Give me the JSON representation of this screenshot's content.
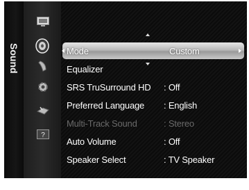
{
  "tab": {
    "label": "Sound"
  },
  "icons": [
    {
      "name": "picture-icon"
    },
    {
      "name": "sound-icon",
      "active": true
    },
    {
      "name": "channel-icon"
    },
    {
      "name": "setup-icon"
    },
    {
      "name": "input-icon"
    },
    {
      "name": "support-icon"
    }
  ],
  "menu": {
    "items": [
      {
        "label": "Mode",
        "value": "Custom",
        "selected": true
      },
      {
        "label": "Equalizer",
        "value": ""
      },
      {
        "label": "SRS TruSurround HD",
        "value": ": Off"
      },
      {
        "label": "Preferred Language",
        "value": ": English"
      },
      {
        "label": "Multi-Track Sound",
        "value": ": Stereo",
        "disabled": true
      },
      {
        "label": "Auto Volume",
        "value": ": Off"
      },
      {
        "label": "Speaker Select",
        "value": ": TV Speaker"
      }
    ]
  },
  "colors": {
    "background": "#050505",
    "highlight": "#c0c0c0",
    "text": "#ffffff",
    "disabled": "#6a6a6a"
  }
}
